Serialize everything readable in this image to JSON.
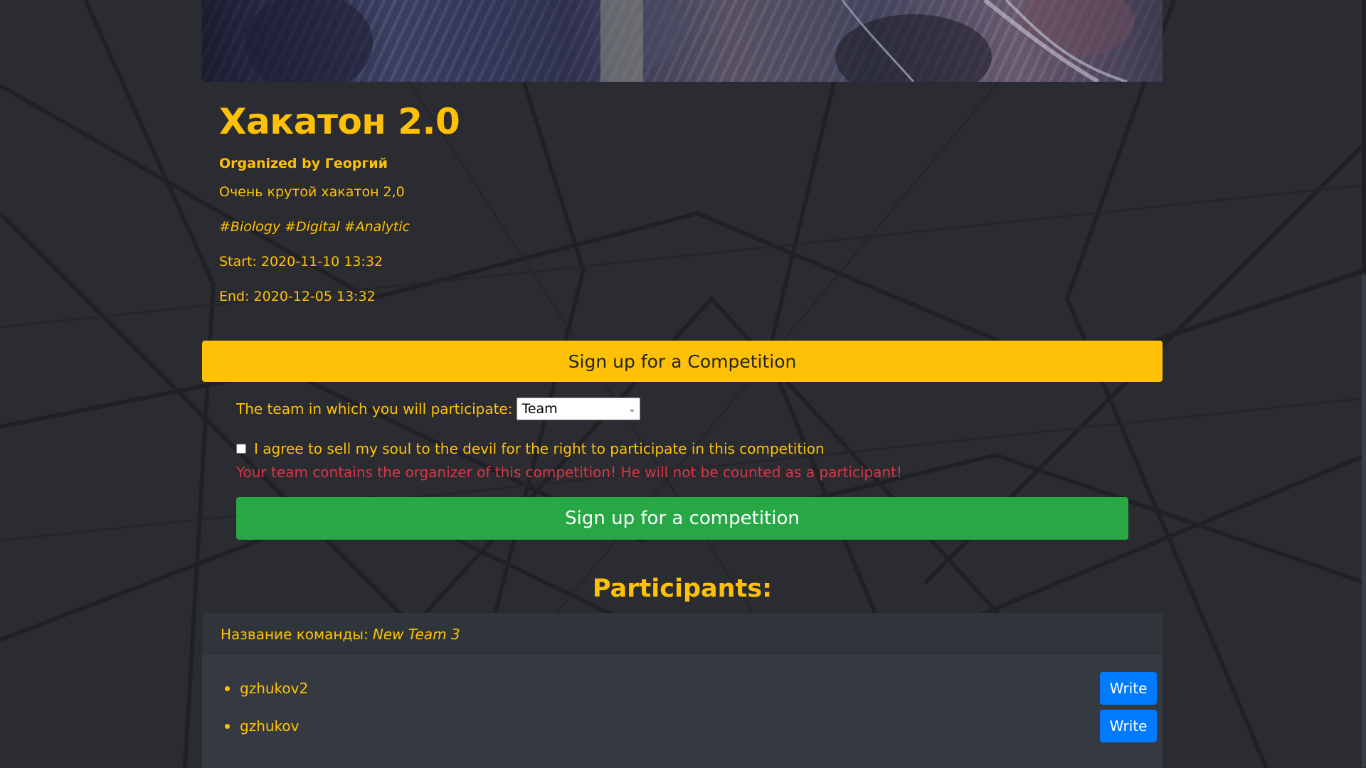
{
  "event": {
    "title": "Хакатон 2.0",
    "organizer": "Organized by Георгий",
    "description": "Очень крутой хакатон 2,0",
    "tags": "#Biology #Digital #Analytic",
    "start": "Start: 2020-11-10 13:32",
    "end": "End: 2020-12-05 13:32"
  },
  "signup": {
    "banner_label": "Sign up for a Competition",
    "team_label": "The team in which you will participate:",
    "team_selected": "Team",
    "agree_label": "I agree to sell my soul to the devil for the right to participate in this competition",
    "agree_checked": false,
    "warning": "Your team contains the organizer of this competition! He will not be counted as a participant!",
    "submit_label": "Sign up for a competition"
  },
  "participants": {
    "title": "Participants:",
    "teams": [
      {
        "name_label": "Название команды:",
        "name": "New Team 3",
        "members": [
          {
            "username": "gzhukov2",
            "action": "Write"
          },
          {
            "username": "gzhukov",
            "action": "Write"
          }
        ]
      }
    ]
  },
  "colors": {
    "accent": "#ffc107",
    "background": "#2a2c31",
    "success": "#28a745",
    "danger": "#dc3545",
    "primary": "#007bff",
    "card": "#343a40"
  },
  "icons": {
    "select_arrow": "chevron-down-icon",
    "bullet": "bullet-icon"
  }
}
